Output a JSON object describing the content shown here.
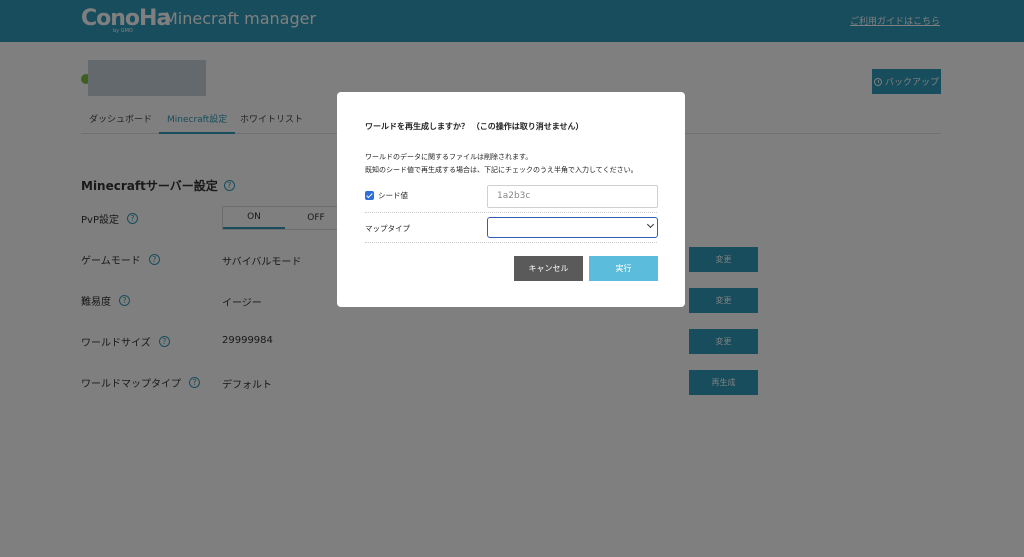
{
  "header": {
    "logo_text": "ConoHa",
    "logo_sub": "by GMO",
    "app_title": "Minecraft manager",
    "guide_link": "ご利用ガイドはこちら"
  },
  "toolbar": {
    "backup_label": "バックアップ"
  },
  "tabs": [
    {
      "label": "ダッシュボード",
      "active": false
    },
    {
      "label": "Minecraft設定",
      "active": true
    },
    {
      "label": "ホワイトリスト",
      "active": false
    },
    {
      "label": "",
      "active": false
    }
  ],
  "settings": {
    "title": "Minecraftサーバー設定",
    "help_glyph": "?",
    "pvp": {
      "label": "PvP設定",
      "on": "ON",
      "off": "OFF"
    },
    "rows": [
      {
        "label": "ゲームモード",
        "value": "サバイバルモード",
        "button": "変更"
      },
      {
        "label": "難易度",
        "value": "イージー",
        "button": "変更"
      },
      {
        "label": "ワールドサイズ",
        "value": "29999984",
        "button": "変更"
      },
      {
        "label": "ワールドマップタイプ",
        "value": "デフォルト",
        "button": "再生成"
      }
    ]
  },
  "modal": {
    "title": "ワールドを再生成しますか？ （この操作は取り消せません）",
    "desc_line1": "ワールドのデータに関するファイルは削除されます。",
    "desc_line2": "既知のシード値で再生成する場合は、下記にチェックのうえ半角で入力してください。",
    "seed_label": "シード値",
    "seed_checked": true,
    "seed_placeholder": "1a2b3c",
    "map_type_label": "マップタイプ",
    "map_type_value": "",
    "cancel_label": "キャンセル",
    "run_label": "実行"
  },
  "colors": {
    "brand": "#2e9ab8",
    "cancel": "#5a5a5a",
    "run": "#5bbcdc",
    "checkbox": "#2f6fdc"
  }
}
